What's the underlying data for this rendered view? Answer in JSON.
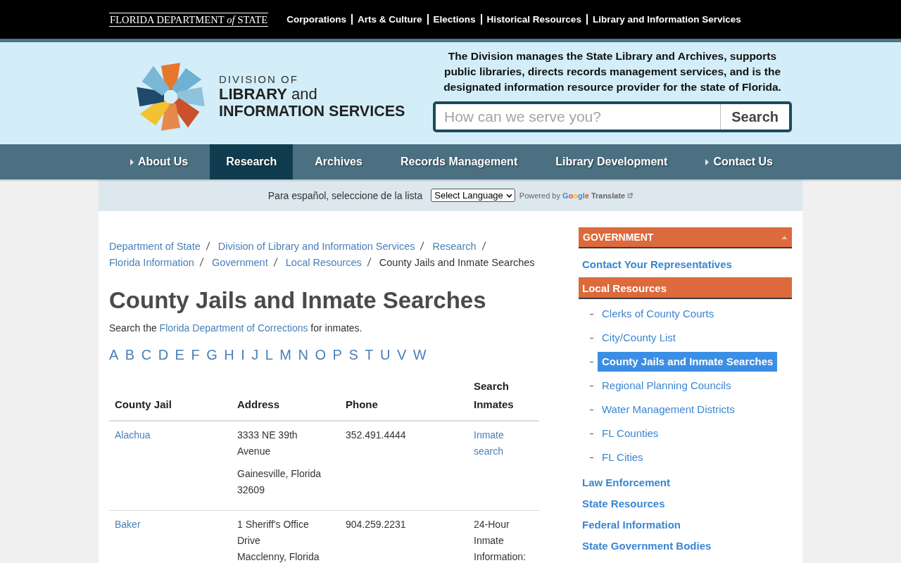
{
  "top_bar": {
    "logo": "FLORIDA DEPARTMENT *of* STATE",
    "links": [
      "Corporations",
      "Arts & Culture",
      "Elections",
      "Historical Resources",
      "Library and Information Services"
    ]
  },
  "header": {
    "logo": {
      "line_1": "DIVISION OF",
      "line_2": "**LIBRARY** and",
      "line_3": "INFORMATION SERVICES"
    },
    "description": "The Division manages the State Library and Archives, supports public libraries, directs records management services, and is the designated information resource provider for the state of Florida.",
    "search": {
      "placeholder": "How can we serve you?",
      "button": "Search"
    }
  },
  "nav": {
    "items": [
      {
        "label": "About Us",
        "submenu": true,
        "selected": false
      },
      {
        "label": "Research",
        "submenu": false,
        "selected": true
      },
      {
        "label": "Archives",
        "submenu": false,
        "selected": false
      },
      {
        "label": "Records Management",
        "submenu": false,
        "selected": false
      },
      {
        "label": "Library Development",
        "submenu": false,
        "selected": false
      },
      {
        "label": "Contact Us",
        "submenu": true,
        "selected": false
      }
    ]
  },
  "translate_bar": {
    "label": "Para español, seleccione de la lista",
    "select": "Select Language",
    "powered_by": "Powered by",
    "brand": "Google",
    "service": "Translate"
  },
  "breadcrumbs": [
    {
      "label": "Department of State",
      "current": false
    },
    {
      "label": "Division of Library and Information Services",
      "current": false
    },
    {
      "label": "Research",
      "current": false
    },
    {
      "label": "Florida Information",
      "current": false
    },
    {
      "label": "Government",
      "current": false
    },
    {
      "label": "Local Resources",
      "current": false
    },
    {
      "label": "County Jails and Inmate Searches",
      "current": true
    }
  ],
  "page": {
    "title": "County Jails and Inmate Searches",
    "intro": {
      "before": "Search the",
      "link": "Florida Department of Corrections",
      "after": "for inmates."
    },
    "letters": [
      "A",
      "B",
      "C",
      "D",
      "E",
      "F",
      "G",
      "H",
      "I",
      "J",
      "L",
      "M",
      "N",
      "O",
      "P",
      "S",
      "T",
      "U",
      "V",
      "W"
    ]
  },
  "table": {
    "columns": [
      "County Jail",
      "Address",
      "Phone",
      "Search Inmates"
    ],
    "rows": [
      {
        "county": "Alachua",
        "address": [
          [
            "3333 NE 39th Avenue"
          ],
          [
            "Gainesville, Florida 32609"
          ]
        ],
        "phone": "352.491.4444",
        "search": {
          "kind": "link",
          "text": "Inmate search"
        }
      },
      {
        "county": "Baker",
        "address": [
          [
            "1 Sheriff's Office Drive",
            "Macclenny, Florida"
          ]
        ],
        "phone": "904.259.2231",
        "search": {
          "kind": "text",
          "text": "24-Hour Inmate Information:"
        }
      }
    ]
  },
  "sidebar": {
    "section": {
      "title": "GOVERNMENT",
      "expanded": true
    },
    "items": [
      {
        "label": "Contact Your Representatives",
        "selected": false
      },
      {
        "label": "Local Resources",
        "selected": true,
        "children": [
          {
            "label": "Clerks of County Courts",
            "selected": false
          },
          {
            "label": "City/County List",
            "selected": false
          },
          {
            "label": "County Jails and Inmate Searches",
            "selected": true
          },
          {
            "label": "Regional Planning Councils",
            "selected": false
          },
          {
            "label": "Water Management Districts",
            "selected": false
          },
          {
            "label": "FL Counties",
            "selected": false
          },
          {
            "label": "FL Cities",
            "selected": false
          }
        ]
      },
      {
        "label": "Law Enforcement",
        "selected": false
      },
      {
        "label": "State Resources",
        "selected": false
      },
      {
        "label": "Federal Information",
        "selected": false
      },
      {
        "label": "State Government Bodies",
        "selected": false
      }
    ]
  }
}
